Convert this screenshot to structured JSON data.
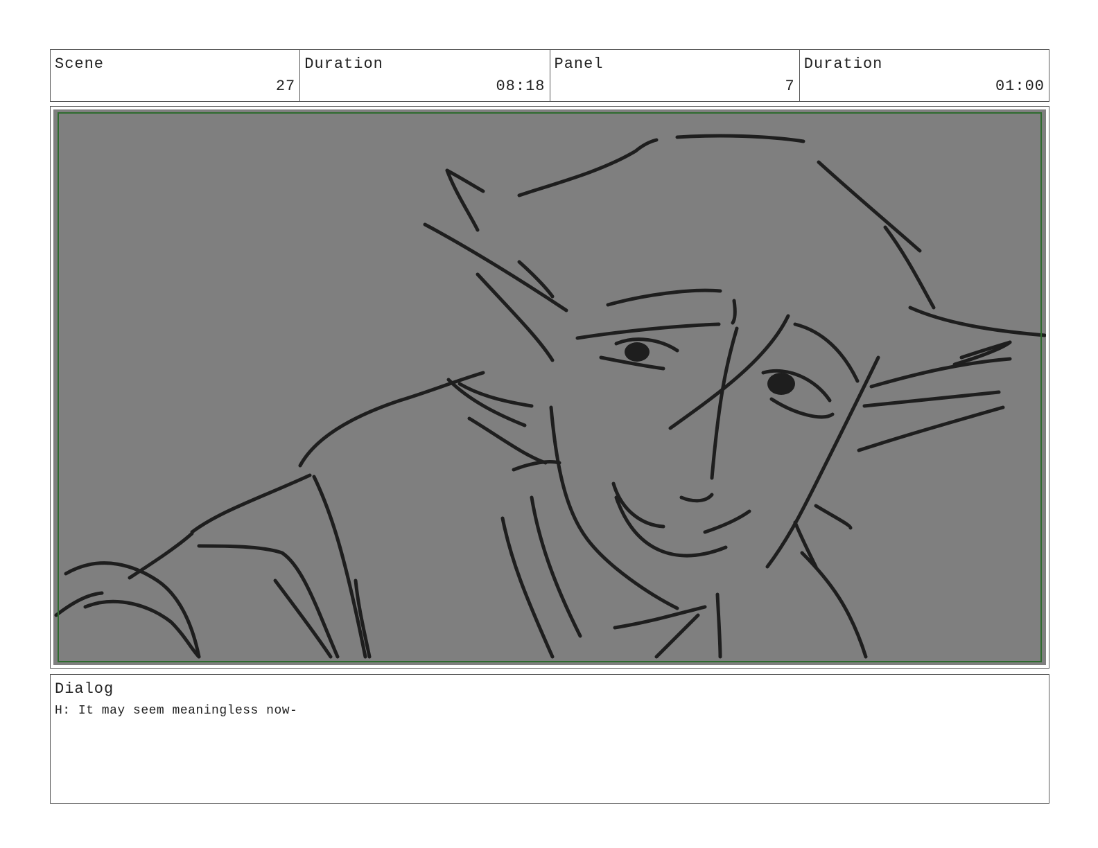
{
  "header": {
    "scene_label": "Scene",
    "scene_value": "27",
    "scene_duration_label": "Duration",
    "scene_duration_value": "08:18",
    "panel_label": "Panel",
    "panel_value": "7",
    "panel_duration_label": "Duration",
    "panel_duration_value": "01:00"
  },
  "dialog": {
    "label": "Dialog",
    "text": "H: It may seem meaningless now-"
  },
  "colors": {
    "panel_background": "#7f7f7f",
    "safe_frame": "#2e6b2e",
    "sketch_stroke": "#1e1e1e"
  }
}
